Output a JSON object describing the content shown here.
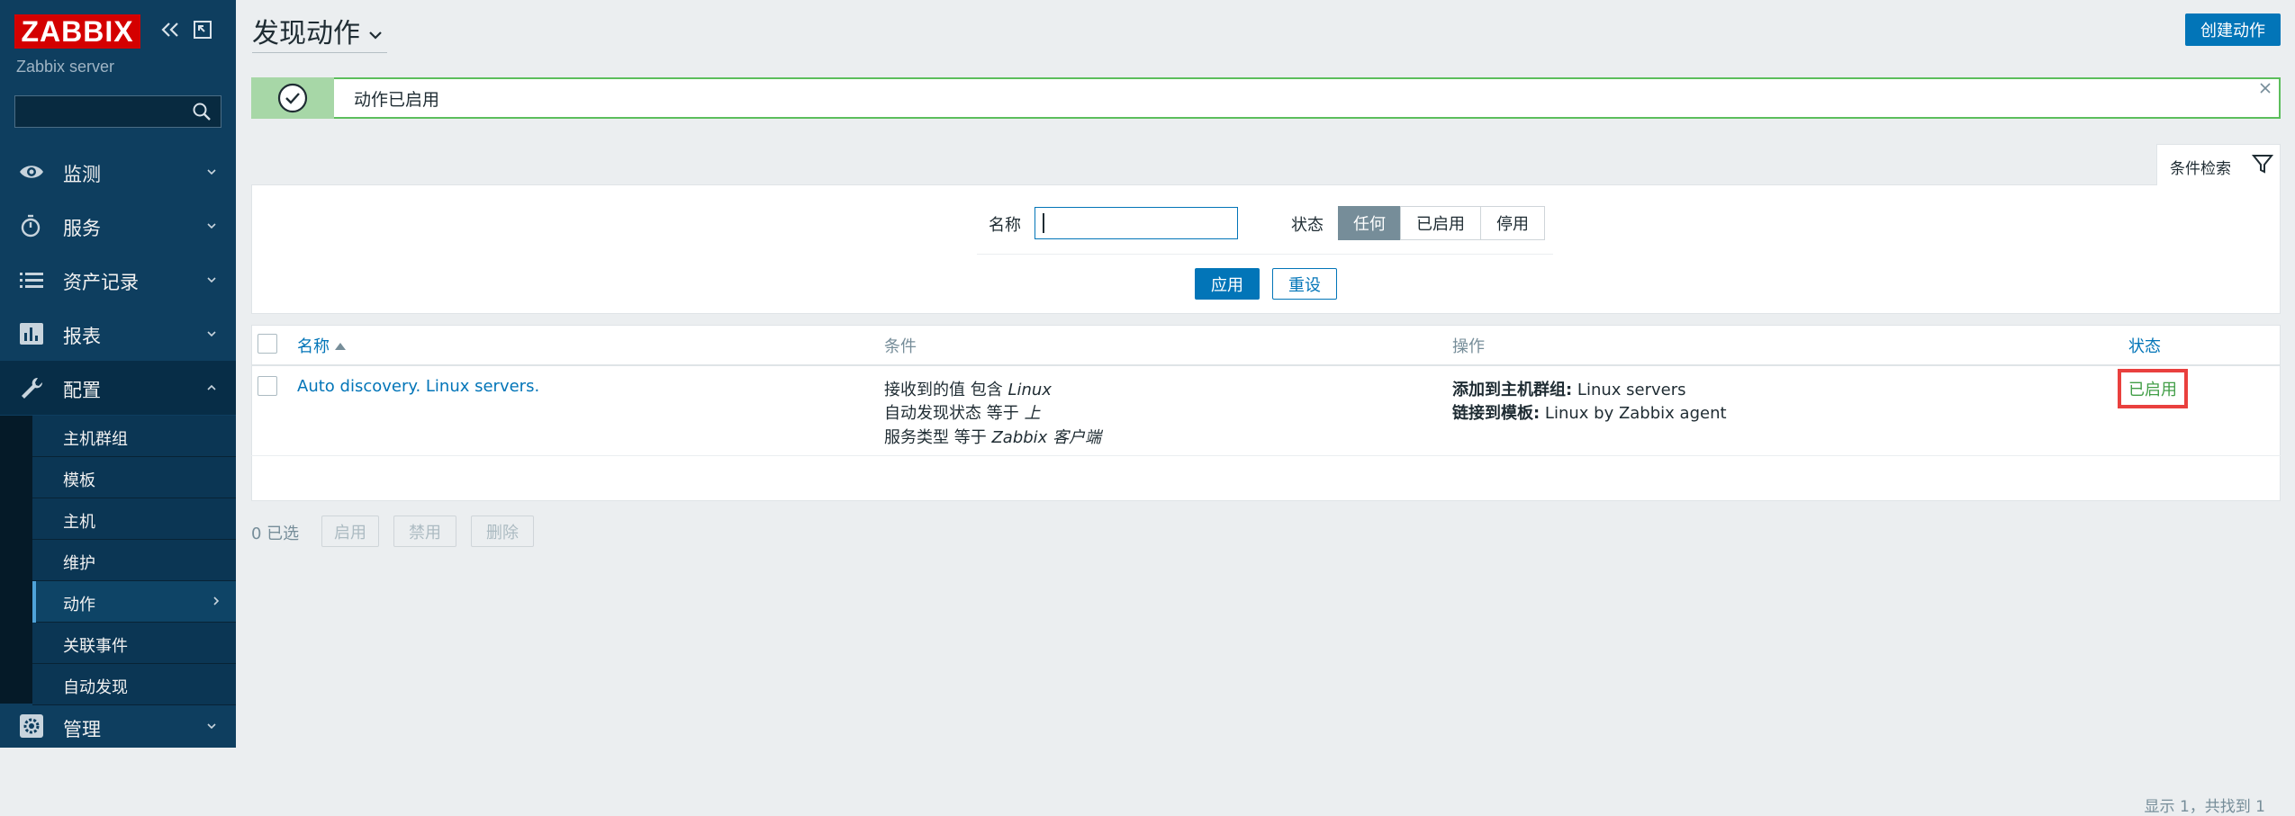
{
  "app": {
    "logo": "ZABBIX",
    "server_name": "Zabbix server",
    "search_placeholder": ""
  },
  "sidebar": {
    "items": [
      {
        "label": "监测",
        "icon": "eye-icon"
      },
      {
        "label": "服务",
        "icon": "stopwatch-icon"
      },
      {
        "label": "资产记录",
        "icon": "list-icon"
      },
      {
        "label": "报表",
        "icon": "bar-chart-icon"
      },
      {
        "label": "配置",
        "icon": "wrench-icon"
      },
      {
        "label": "管理",
        "icon": "gear-icon"
      }
    ],
    "submenu": [
      {
        "label": "主机群组"
      },
      {
        "label": "模板"
      },
      {
        "label": "主机"
      },
      {
        "label": "维护"
      },
      {
        "label": "动作"
      },
      {
        "label": "关联事件"
      },
      {
        "label": "自动发现"
      }
    ]
  },
  "header": {
    "title": "发现动作",
    "create_button": "创建动作"
  },
  "message": {
    "text": "动作已启用"
  },
  "filter": {
    "tab_label": "条件检索",
    "name_label": "名称",
    "name_value": "",
    "status_label": "状态",
    "status_options": [
      "任何",
      "已启用",
      "停用"
    ],
    "status_selected": "任何",
    "apply": "应用",
    "reset": "重设"
  },
  "table": {
    "headers": {
      "name": "名称",
      "conditions": "条件",
      "operations": "操作",
      "status": "状态"
    },
    "rows": [
      {
        "name": "Auto discovery. Linux servers.",
        "conditions": [
          {
            "text": "接收到的值 包含 ",
            "value": "Linux"
          },
          {
            "text": "自动发现状态 等于 ",
            "value": "上"
          },
          {
            "text": "服务类型 等于 ",
            "value": "Zabbix 客户端"
          }
        ],
        "operations": [
          {
            "label": "添加到主机群组:",
            "value": " Linux servers"
          },
          {
            "label": "链接到模板:",
            "value": " Linux by Zabbix agent"
          }
        ],
        "status": "已启用"
      }
    ],
    "paging": "显示 1，共找到 1"
  },
  "footer": {
    "selected": "0 已选",
    "enable": "启用",
    "disable": "禁用",
    "delete": "删除"
  },
  "colors": {
    "sidebar": "#0e3e5f",
    "accent": "#0275b8",
    "logo": "#d40000",
    "success": "#429e47",
    "highlight": "#e9403e"
  }
}
